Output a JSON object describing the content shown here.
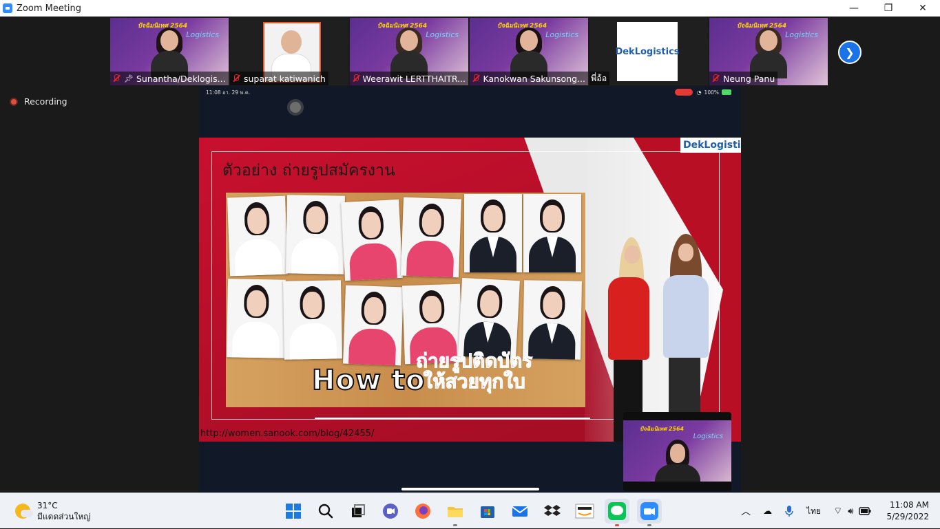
{
  "window": {
    "title": "Zoom Meeting",
    "controls": {
      "minimize": "—",
      "restore": "❐",
      "close": "✕"
    }
  },
  "gallery": {
    "participants": [
      {
        "name": "Sunantha/Deklogis...",
        "video": "promo-person",
        "muted": true,
        "pinned": true,
        "active": true
      },
      {
        "name": "suparat katiwanich",
        "video": "photo-man",
        "muted": true,
        "pinned": false,
        "active": false
      },
      {
        "name": "Weerawit LERTTHAITR...",
        "video": "promo-man",
        "muted": true,
        "pinned": false,
        "active": false
      },
      {
        "name": "Kanokwan Sakunsong...",
        "video": "promo-woman",
        "muted": true,
        "pinned": false,
        "active": false
      },
      {
        "name": "พี่อ้อ",
        "video": "logo",
        "logo_text": "DekLogistics",
        "muted": false,
        "pinned": false,
        "active": false
      },
      {
        "name": "Neung Panu",
        "video": "promo-man2",
        "muted": true,
        "pinned": false,
        "active": false
      }
    ],
    "promo_banner": "ปัจฉิมนิเทศ 2564",
    "promo_logistics": "Logistics",
    "next_icon": "chevron-right-icon"
  },
  "recording": {
    "label": "Recording"
  },
  "share": {
    "statusbar": {
      "time": "11:08  อา. 29 พ.ค.",
      "battery": "100%"
    },
    "slide": {
      "brand": "DekLogistic",
      "title": "ตัวอย่าง ถ่ายรูปสมัครงาน",
      "how_to": "How  to",
      "thai_line1": "ถ่ายรูปติดบัตร",
      "thai_line2": "ให้สวยทุกใบ",
      "url": "http://women.sanook.com/blog/42455/"
    }
  },
  "selfview": {
    "banner": "ปัจฉิมนิเทศ 2564",
    "logistics": "Logistics"
  },
  "taskbar": {
    "weather": {
      "temp": "31°C",
      "desc": "มีแดดส่วนใหญ่"
    },
    "apps": [
      "start",
      "search",
      "task-view",
      "teams-chat",
      "firefox",
      "file-explorer",
      "microsoft-store",
      "mail",
      "dropbox",
      "amazon",
      "line",
      "zoom"
    ],
    "tray": {
      "language": "ไทย",
      "time": "11:08 AM",
      "date": "5/29/2022"
    }
  }
}
